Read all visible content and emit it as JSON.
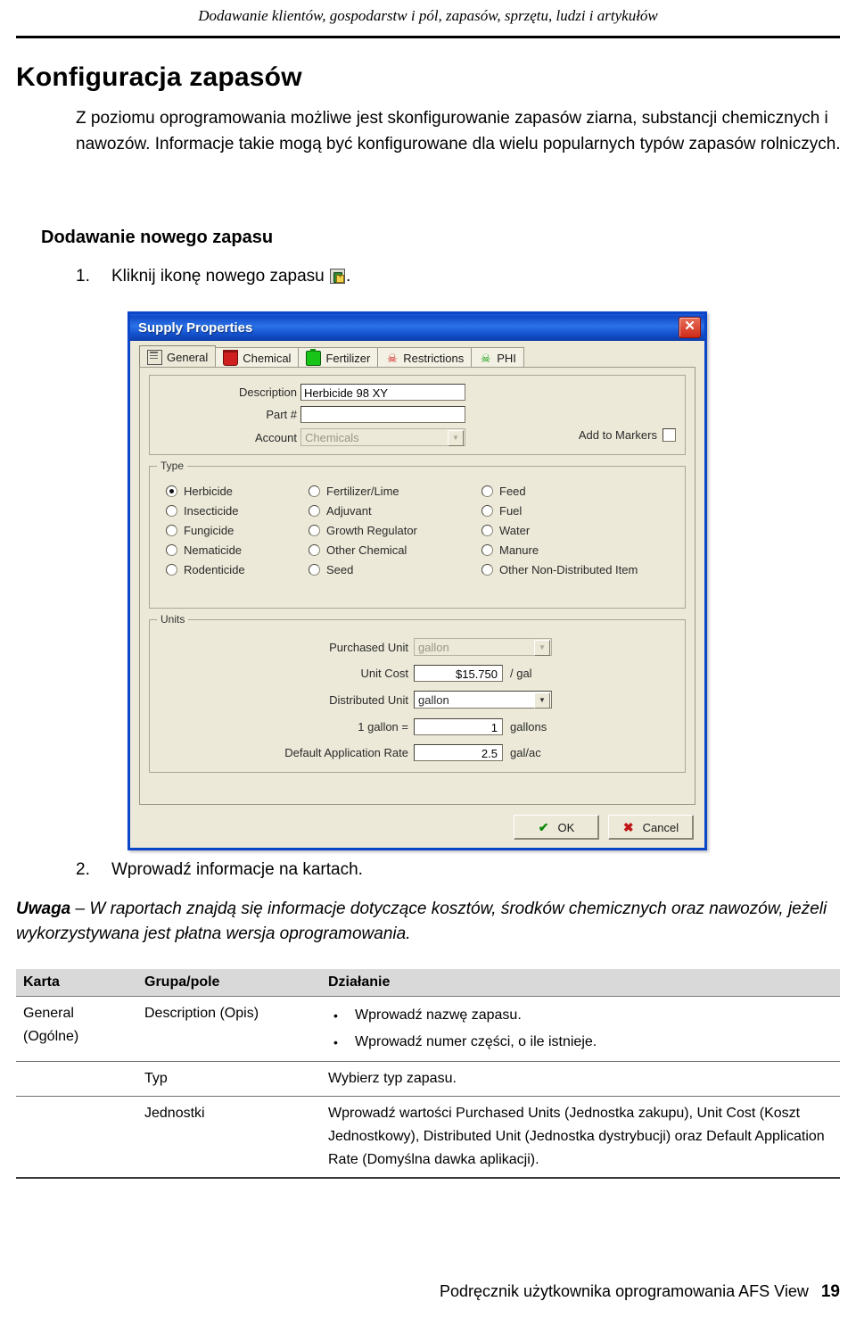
{
  "document": {
    "running_header": "Dodawanie klientów, gospodarstw i pól, zapasów, sprzętu, ludzi i artykułów",
    "page_title": "Konfiguracja zapasów",
    "intro": "Z poziomu oprogramowania możliwe jest skonfigurowanie zapasów ziarna, substancji chemicznych i nawozów. Informacje takie mogą być konfigurowane dla wielu popularnych typów zapasów rolniczych.",
    "section_title": "Dodawanie nowego zapasu",
    "steps": [
      {
        "num": "1.",
        "text_before": "Kliknij ikonę nowego zapasu",
        "icon": "new-supply-icon",
        "text_after": "."
      },
      {
        "num": "2.",
        "text_before": "Wprowadź informacje na kartach.",
        "icon": "",
        "text_after": ""
      }
    ],
    "note": {
      "label": "Uwaga",
      "dash": " – ",
      "text": "W raportach znajdą się informacje dotyczące kosztów, środków chemicznych oraz nawozów, jeżeli wykorzystywana jest płatna wersja oprogramowania."
    },
    "footer": {
      "text": "Podręcznik użytkownika oprogramowania AFS View",
      "page_number": "19"
    }
  },
  "dialog": {
    "title": "Supply Properties",
    "close_label": "✕",
    "tabs": [
      {
        "label": "General",
        "icon": "clipboard-icon",
        "active": true
      },
      {
        "label": "Chemical",
        "icon": "bucket-icon",
        "active": false
      },
      {
        "label": "Fertilizer",
        "icon": "bottle-icon",
        "active": false
      },
      {
        "label": "Restrictions",
        "icon": "skull-red-icon",
        "active": false
      },
      {
        "label": "PHI",
        "icon": "skull-green-icon",
        "active": false
      }
    ],
    "general": {
      "description_label": "Description",
      "description_value": "Herbicide 98 XY",
      "part_label": "Part #",
      "part_value": "",
      "account_label": "Account",
      "account_value": "Chemicals",
      "add_to_markers_label": "Add to Markers",
      "add_to_markers_checked": false
    },
    "type_group": {
      "legend": "Type",
      "selected": "Herbicide",
      "columns": [
        [
          "Herbicide",
          "Insecticide",
          "Fungicide",
          "Nematicide",
          "Rodenticide"
        ],
        [
          "Fertilizer/Lime",
          "Adjuvant",
          "Growth Regulator",
          "Other Chemical",
          "Seed"
        ],
        [
          "Feed",
          "Fuel",
          "Water",
          "Manure",
          "Other Non-Distributed Item"
        ]
      ]
    },
    "units_group": {
      "legend": "Units",
      "rows": [
        {
          "label": "Purchased Unit",
          "value": "gallon",
          "suffix": "",
          "kind": "combo-disabled"
        },
        {
          "label": "Unit Cost",
          "value": "$15.750",
          "suffix": "/ gal",
          "kind": "text-right"
        },
        {
          "label": "Distributed Unit",
          "value": "gallon",
          "suffix": "",
          "kind": "combo"
        },
        {
          "label": "1 gallon =",
          "value": "1",
          "suffix": "gallons",
          "kind": "text-right"
        },
        {
          "label": "Default Application Rate",
          "value": "2.5",
          "suffix": "gal/ac",
          "kind": "text-right"
        }
      ]
    },
    "buttons": [
      {
        "label": "OK",
        "glyph": "check-icon"
      },
      {
        "label": "Cancel",
        "glyph": "x-icon"
      }
    ]
  },
  "table": {
    "headers": [
      "Karta",
      "Grupa/pole",
      "Działanie"
    ],
    "rows": [
      {
        "karta": "General\n(Ogólne)",
        "grupa": "Description (Opis)",
        "dzialanie_bullets": [
          "Wprowadź nazwę zapasu.",
          "Wprowadź numer części, o ile istnieje."
        ],
        "dzialanie_text": ""
      },
      {
        "karta": "",
        "grupa": "Typ",
        "dzialanie_bullets": [],
        "dzialanie_text": "Wybierz typ zapasu."
      },
      {
        "karta": "",
        "grupa": "Jednostki",
        "dzialanie_bullets": [],
        "dzialanie_text": "Wprowadź wartości Purchased Units (Jednostka zakupu), Unit Cost (Koszt Jednostkowy), Distributed Unit (Jednostka dystrybucji) oraz Default Application Rate (Domyślna dawka aplikacji)."
      }
    ]
  },
  "colors": {
    "title_bar_blue": "#1450cd",
    "dialog_face": "#ece9d8",
    "dialog_border": "#0a46c8",
    "table_header_gray": "#d9d9d9",
    "close_red": "#cf2a18"
  }
}
